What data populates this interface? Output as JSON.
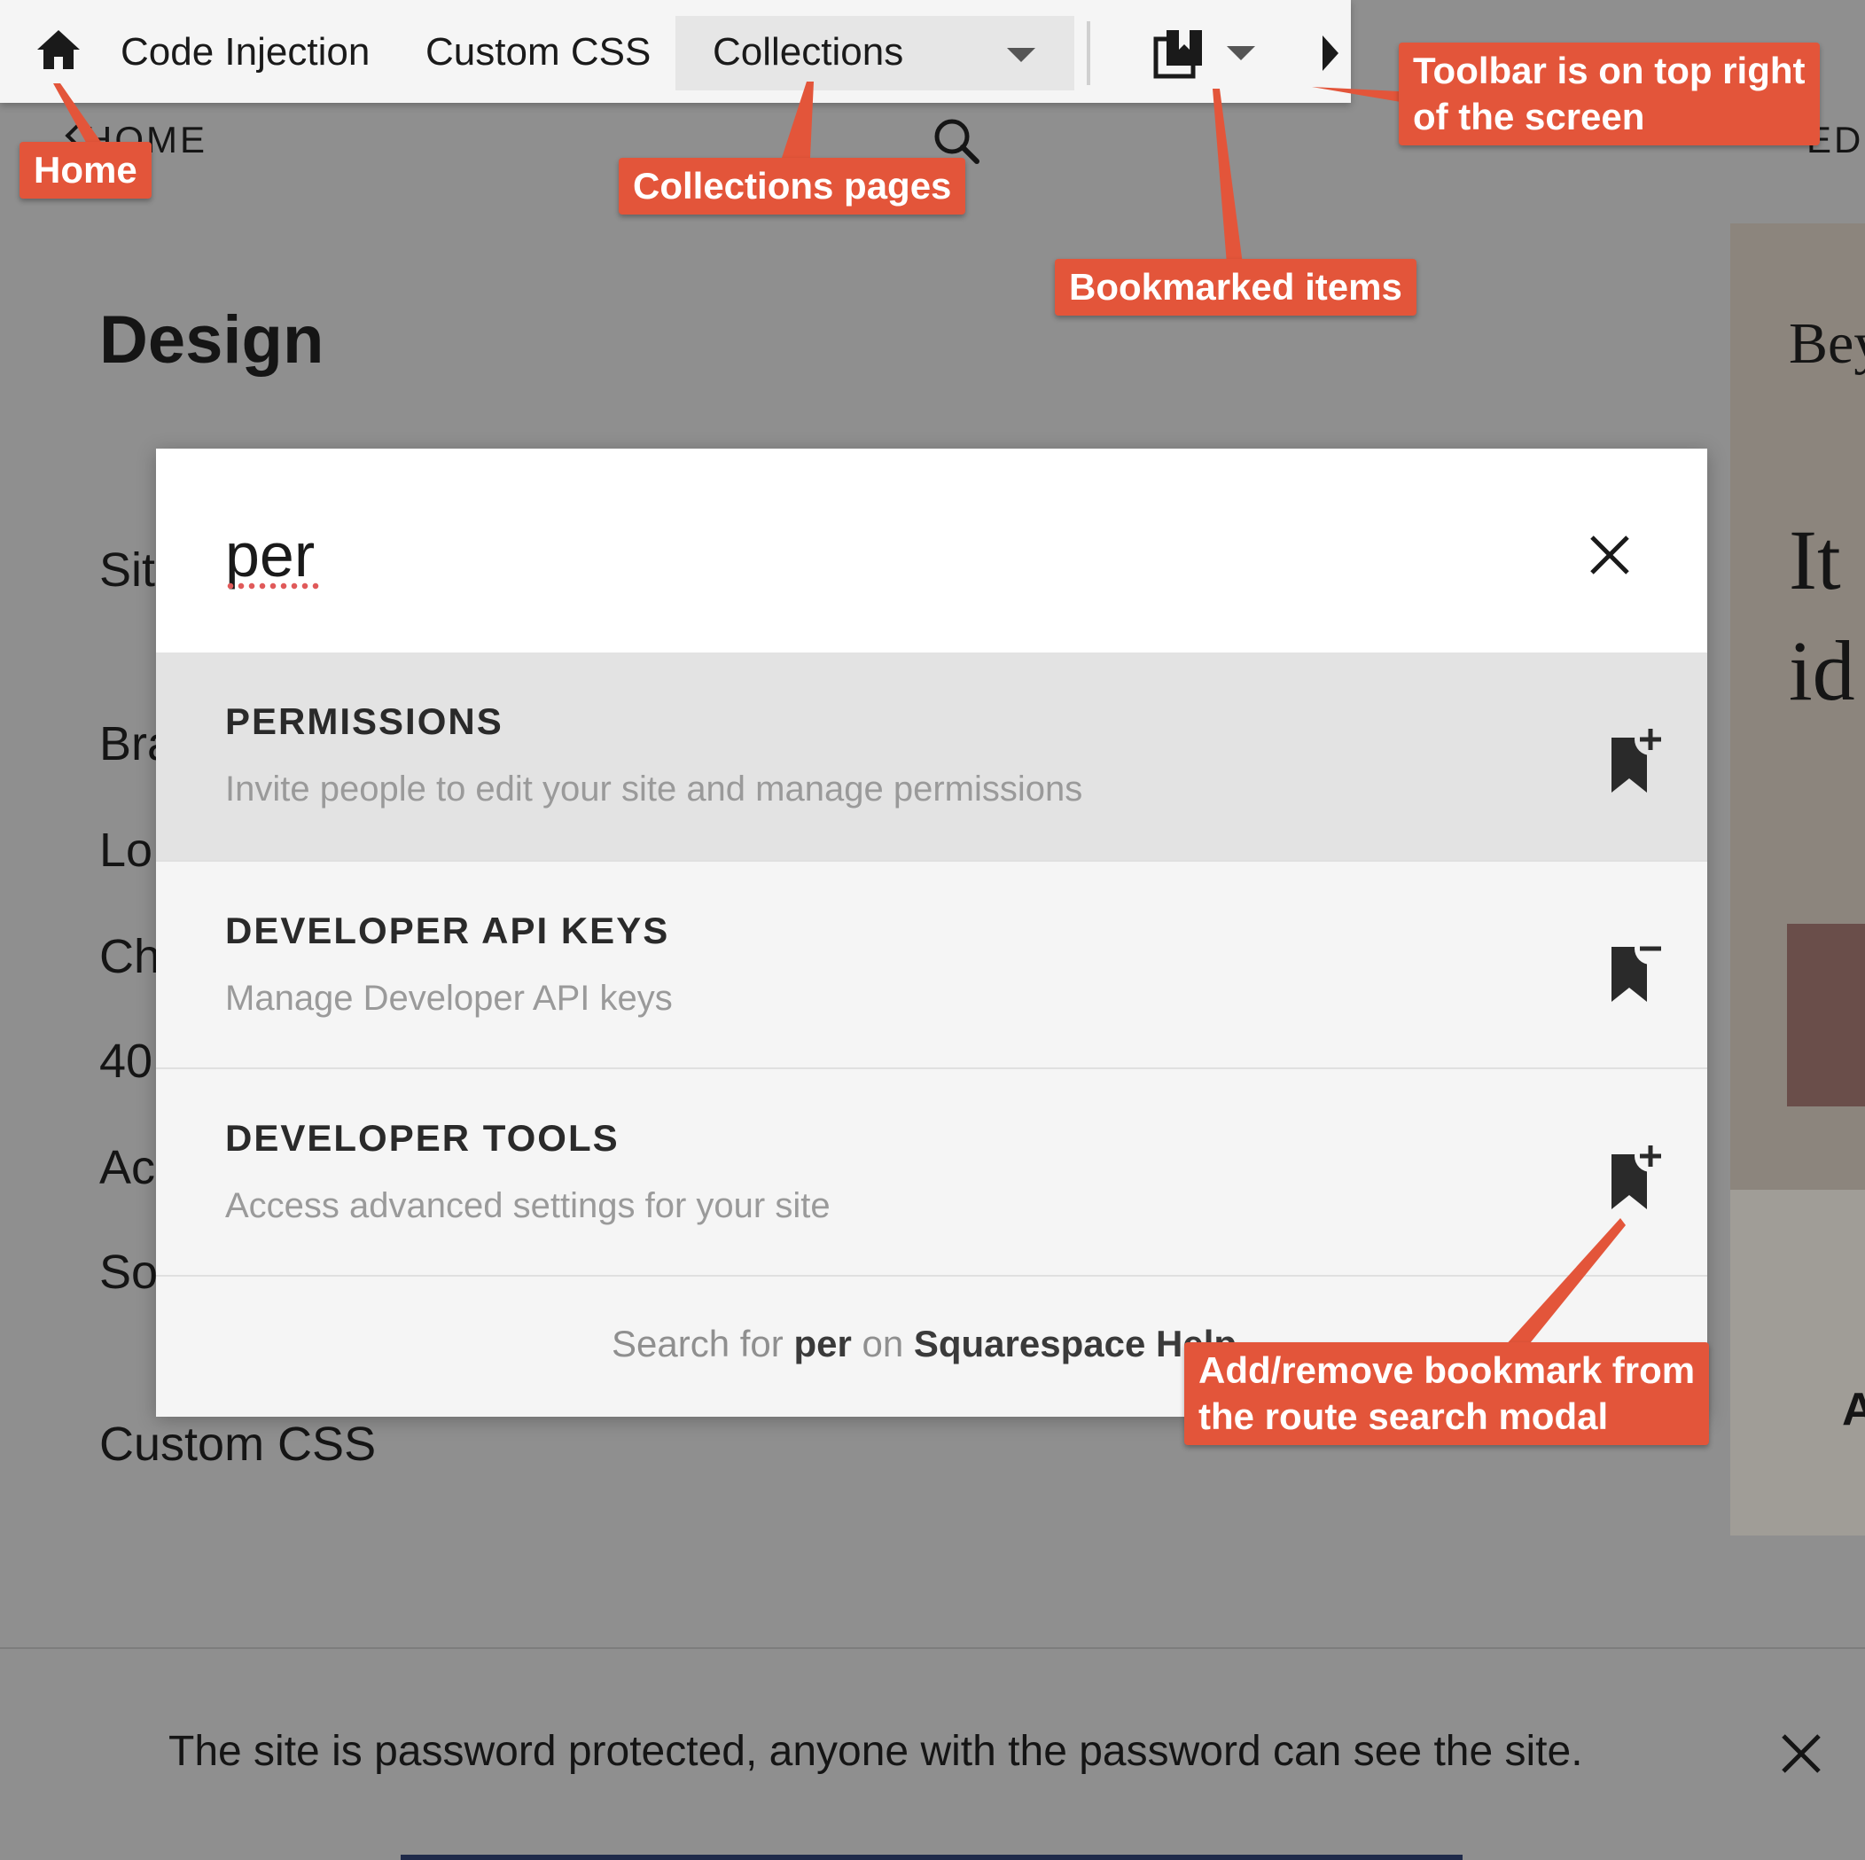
{
  "background": {
    "home_label": "HOME",
    "page_title": "Design",
    "menu_items": [
      "Sit",
      "Bra",
      "Lo",
      "Ch",
      "40",
      "Ac",
      "So"
    ],
    "custom_css_label": "Custom CSS",
    "preview": {
      "edit_label": "EDI",
      "heading": "Bey",
      "body_line1": "It",
      "body_line2": "id",
      "footer_letter": "A"
    }
  },
  "toolbar": {
    "code_injection": "Code Injection",
    "custom_css": "Custom CSS",
    "collections_select": "Collections"
  },
  "search_modal": {
    "query": "per",
    "results": [
      {
        "title": "PERMISSIONS",
        "description": "Invite people to edit your site and manage permissions",
        "bookmark_action": "add"
      },
      {
        "title": "DEVELOPER API KEYS",
        "description": "Manage Developer API keys",
        "bookmark_action": "remove"
      },
      {
        "title": "DEVELOPER TOOLS",
        "description": "Access advanced settings for your site",
        "bookmark_action": "add"
      }
    ],
    "footer": {
      "prefix": "Search for",
      "query": "per",
      "middle": "on",
      "site": "Squarespace Help"
    }
  },
  "banner": {
    "text": "The site is password protected, anyone with the password can see the site."
  },
  "annotations": {
    "home": "Home",
    "collections": "Collections pages",
    "bookmarks": "Bookmarked items",
    "toolbar_line1": "Toolbar is on top right",
    "toolbar_line2": "of the screen",
    "bookmark_toggle_line1": "Add/remove bookmark from",
    "bookmark_toggle_line2": "the route search modal",
    "color": "#e3553a"
  }
}
